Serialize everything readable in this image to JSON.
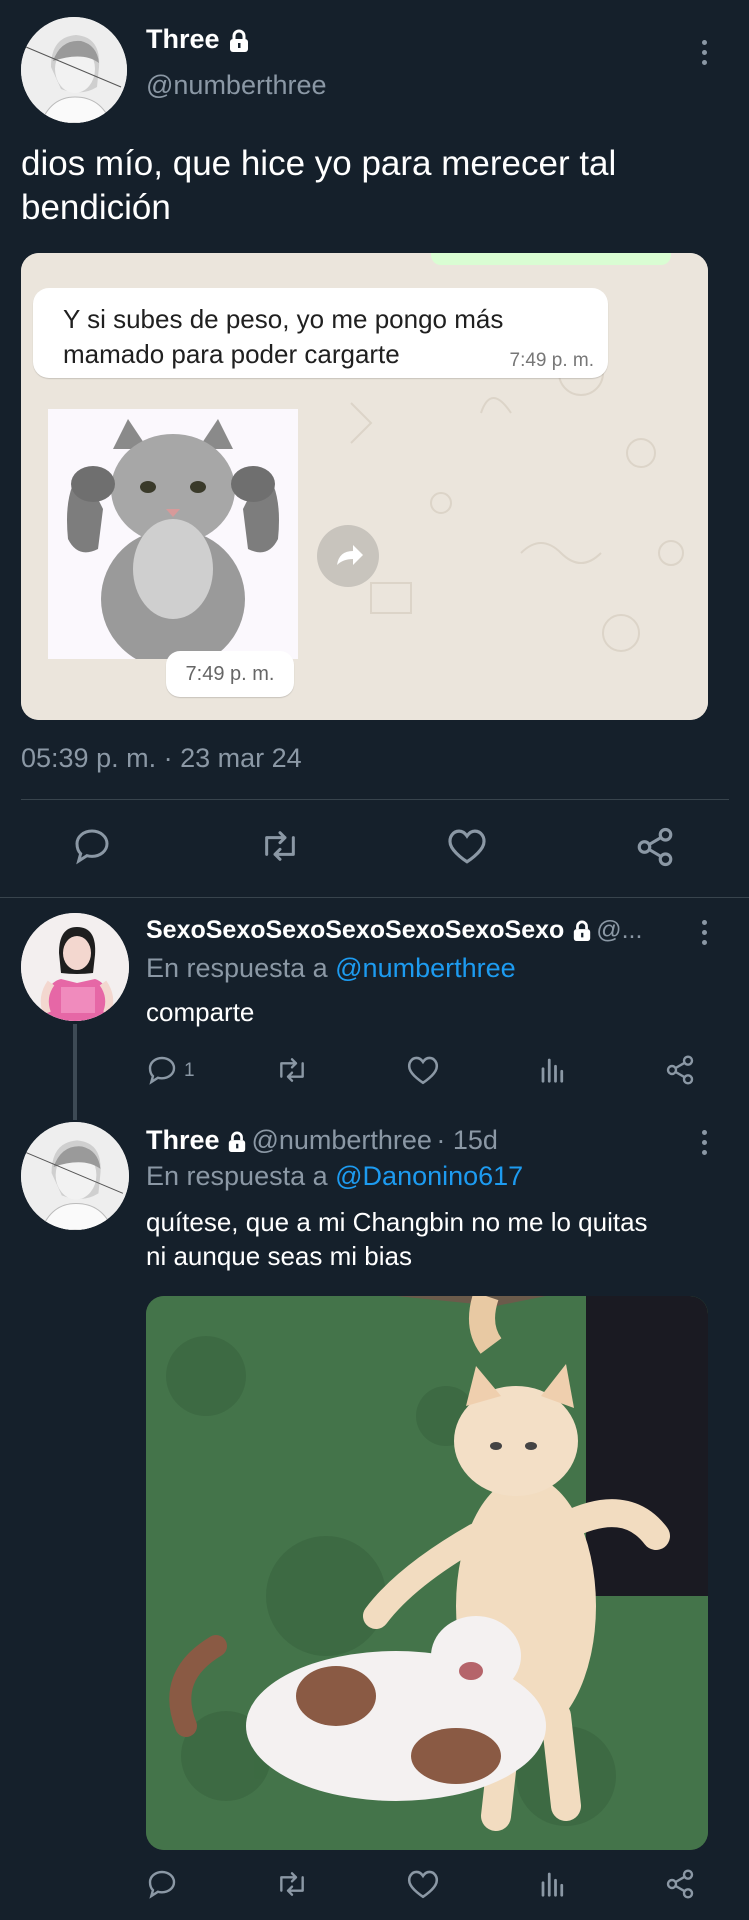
{
  "tweet": {
    "name": "Three",
    "handle": "@numberthree",
    "text": "dios mío, que hice yo para merecer tal bendición",
    "timestamp": "05:39 p. m. · 23 mar 24",
    "chat": {
      "message": "Y si subes de peso, yo me pongo más mamado para poder cargarte",
      "message_time": "7:49 p. m.",
      "sticker_time": "7:49 p. m."
    },
    "actions": [
      "reply-icon",
      "retweet-icon",
      "like-icon",
      "share-icon"
    ]
  },
  "reply1": {
    "name": "SexoSexoSexoSexoSexoSexoSexo",
    "handle_trunc": "@...",
    "reply_prefix": "En respuesta a",
    "reply_to": "@numberthree",
    "text": "comparte",
    "reply_count": "1"
  },
  "reply2": {
    "name": "Three",
    "handle": "@numberthree",
    "age": "· 15d",
    "reply_prefix": "En respuesta a",
    "reply_to": "@Danonino617",
    "text_line1": "quítese, que a mi Changbin no me lo quitas",
    "text_line2": "ni aunque seas mi bias"
  },
  "colors": {
    "background": "#15202b",
    "text": "#ffffff",
    "muted": "#8b98a5",
    "link": "#1d9bf0",
    "divider": "#38444d"
  }
}
